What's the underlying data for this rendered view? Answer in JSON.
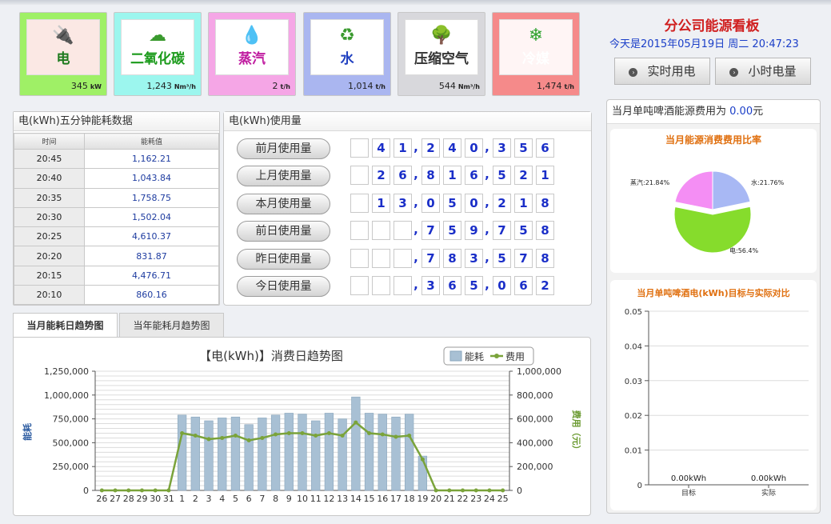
{
  "tiles": [
    {
      "name": "电",
      "value": "345",
      "unit": "kW",
      "bg": "#9ff066",
      "icon": "plug-icon",
      "color": "#1e7a1e"
    },
    {
      "name": "二氧化碳",
      "value": "1,243",
      "unit": "Nm³/h",
      "bg": "#9cf6ee",
      "icon": "co2-icon",
      "color": "#1a9a1a"
    },
    {
      "name": "蒸汽",
      "value": "2",
      "unit": "t/h",
      "bg": "#f5a6e6",
      "icon": "steam-icon",
      "color": "#c01ca0"
    },
    {
      "name": "水",
      "value": "1,014",
      "unit": "t/h",
      "bg": "#aab6f0",
      "icon": "water-drop-icon",
      "color": "#2040c0"
    },
    {
      "name": "压缩空气",
      "value": "544",
      "unit": "Nm³/h",
      "bg": "#d8d8dc",
      "icon": "tree-icon",
      "color": "#333"
    },
    {
      "name": "冷媒",
      "value": "1,474",
      "unit": "t/h",
      "bg": "#f58a8a",
      "icon": "snowflake-icon",
      "color": "#ffffff"
    }
  ],
  "header": {
    "title": "分公司能源看板",
    "date": "今天是2015年05月19日 周二 20:47:23",
    "btn_realtime": "实时用电",
    "btn_hourly": "小时电量"
  },
  "five_min": {
    "title": "电(kWh)五分钟能耗数据",
    "col_time": "时间",
    "col_value": "能耗值",
    "rows": [
      [
        "20:45",
        "1,162.21"
      ],
      [
        "20:40",
        "1,043.84"
      ],
      [
        "20:35",
        "1,758.75"
      ],
      [
        "20:30",
        "1,502.04"
      ],
      [
        "20:25",
        "4,610.37"
      ],
      [
        "20:20",
        "831.87"
      ],
      [
        "20:15",
        "4,476.71"
      ],
      [
        "20:10",
        "860.16"
      ]
    ]
  },
  "usage": {
    "title": "电(kWh)使用量",
    "rows": [
      {
        "label": "前月使用量",
        "digits": [
          "",
          "4",
          "1",
          ",",
          "2",
          "4",
          "0",
          ",",
          "3",
          "5",
          "6"
        ]
      },
      {
        "label": "上月使用量",
        "digits": [
          "",
          "2",
          "6",
          ",",
          "8",
          "1",
          "6",
          ",",
          "5",
          "2",
          "1"
        ]
      },
      {
        "label": "本月使用量",
        "digits": [
          "",
          "1",
          "3",
          ",",
          "0",
          "5",
          "0",
          ",",
          "2",
          "1",
          "8"
        ]
      },
      {
        "label": "前日使用量",
        "digits": [
          "",
          "",
          "",
          ",",
          "7",
          "5",
          "9",
          ",",
          "7",
          "5",
          "8"
        ]
      },
      {
        "label": "昨日使用量",
        "digits": [
          "",
          "",
          "",
          ",",
          "7",
          "8",
          "3",
          ",",
          "5",
          "7",
          "8"
        ]
      },
      {
        "label": "今日使用量",
        "digits": [
          "",
          "",
          "",
          ",",
          "3",
          "6",
          "5",
          ",",
          "0",
          "6",
          "2"
        ]
      }
    ]
  },
  "tabs": {
    "tab1": "当月能耗日趋势图",
    "tab2": "当年能耗月趋势图"
  },
  "cost_line": {
    "prefix": "当月单吨啤酒能源费用为 ",
    "value": "0.00",
    "suffix": "元"
  },
  "pie_title": "当月能源消费费用比率",
  "pie_labels": {
    "steam": "蒸汽:21.84%",
    "water": "水:21.76%",
    "elec": "电:56.4%"
  },
  "target_title": "当月单吨啤酒电(kWh)目标与实际对比",
  "chart_data": [
    {
      "type": "bar",
      "title": "【电(kWh)】消费日趋势图",
      "ylabel": "能耗",
      "y2label": "费用（元）",
      "ylim": [
        0,
        1250000
      ],
      "y2lim": [
        0,
        1000000
      ],
      "y_ticks": [
        "0",
        "250,000",
        "500,000",
        "750,000",
        "1,000,000",
        "1,250,000"
      ],
      "y2_ticks": [
        "0",
        "200,000",
        "400,000",
        "600,000",
        "800,000",
        "1,000,000"
      ],
      "legend": [
        "能耗",
        "费用"
      ],
      "legend_position": "top-right",
      "grid": true,
      "categories": [
        "26",
        "27",
        "28",
        "29",
        "30",
        "31",
        "1",
        "2",
        "3",
        "4",
        "5",
        "6",
        "7",
        "8",
        "9",
        "10",
        "11",
        "12",
        "13",
        "14",
        "15",
        "16",
        "17",
        "18",
        "19",
        "20",
        "21",
        "22",
        "23",
        "24",
        "25"
      ],
      "series": [
        {
          "name": "能耗",
          "type": "bar",
          "color": "#a8c0d4",
          "values": [
            0,
            0,
            0,
            0,
            0,
            0,
            790000,
            770000,
            730000,
            760000,
            770000,
            690000,
            760000,
            790000,
            810000,
            800000,
            730000,
            810000,
            750000,
            980000,
            810000,
            800000,
            770000,
            800000,
            360000,
            0,
            0,
            0,
            0,
            0,
            0
          ]
        },
        {
          "name": "费用",
          "type": "line",
          "color": "#7aa33a",
          "values": [
            0,
            0,
            0,
            0,
            0,
            0,
            480000,
            460000,
            430000,
            440000,
            460000,
            420000,
            440000,
            470000,
            480000,
            480000,
            460000,
            480000,
            460000,
            570000,
            480000,
            470000,
            450000,
            460000,
            260000,
            0,
            0,
            0,
            0,
            0,
            0
          ]
        }
      ]
    },
    {
      "type": "pie",
      "title": "当月能源消费费用比率",
      "slices": [
        {
          "label": "水",
          "value": 21.76,
          "color": "#a8b8f4"
        },
        {
          "label": "电",
          "value": 56.4,
          "color": "#86dc2c"
        },
        {
          "label": "蒸汽",
          "value": 21.84,
          "color": "#f48ef4"
        }
      ]
    },
    {
      "type": "bar",
      "title": "当月单吨啤酒电(kWh)目标与实际对比",
      "categories": [
        "目标",
        "实际"
      ],
      "values": [
        0,
        0
      ],
      "data_labels": [
        "0.00kWh",
        "0.00kWh"
      ],
      "ylim": [
        0,
        0.05
      ],
      "y_ticks": [
        "0",
        "0.01",
        "0.02",
        "0.03",
        "0.04",
        "0.05"
      ]
    }
  ]
}
